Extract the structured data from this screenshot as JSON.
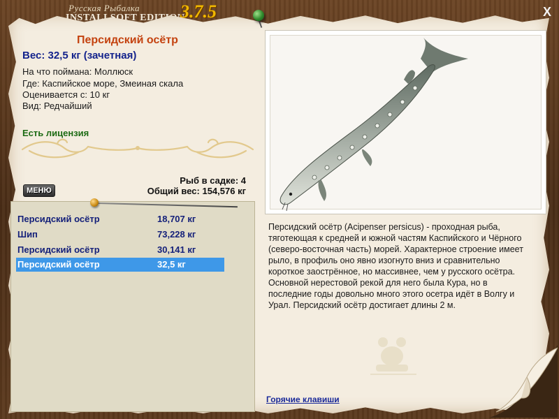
{
  "header": {
    "logo_line1": "Русская Рыбалка",
    "logo_line2": "INSTALLSOFT EDITION",
    "version": "3.7.5",
    "close_label": "X"
  },
  "fish": {
    "title": "Персидский осётр",
    "weight_line": "Вес: 32,5 кг (зачетная)",
    "caught_on": "На что поймана: Моллюск",
    "location": "Где: Каспийское море, Змеиная скала",
    "rated_from": "Оценивается с: 10 кг",
    "rarity": "Вид: Редчайший",
    "license": "Есть лицензия"
  },
  "keepnet": {
    "fish_count": "Рыб в садке: 4",
    "total_weight": "Общий вес: 154,576 кг"
  },
  "menu_label": "МЕНЮ",
  "catches": [
    {
      "name": "Персидский осётр",
      "weight": "18,707 кг"
    },
    {
      "name": "Шип",
      "weight": "73,228 кг"
    },
    {
      "name": "Персидский осётр",
      "weight": "30,141 кг"
    },
    {
      "name": "Персидский осётр",
      "weight": "32,5 кг"
    }
  ],
  "selected_catch": 3,
  "description": "Персидский осётр (Acipenser persicus) - проходная рыба, тяготеющая к средней и южной частям Каспийского и Чёрного (северо-восточная часть) морей. Характерное строение имеет рыло, в профиль оно явно изогнуто вниз и сравнительно короткое заострённое, но массивнее, чем у русского осётра. Основной нерестовой рекой для него была Кура, но в последние годы довольно много этого осетра идёт в Волгу и Урал. Персидский осётр достигает длины 2 м.",
  "hotkeys_label": "Горячие клавиши",
  "colors": {
    "title": "#c4420f",
    "weight": "#14238c",
    "license": "#1d6b14",
    "selection": "#3e98e8",
    "version": "#f0b800"
  }
}
